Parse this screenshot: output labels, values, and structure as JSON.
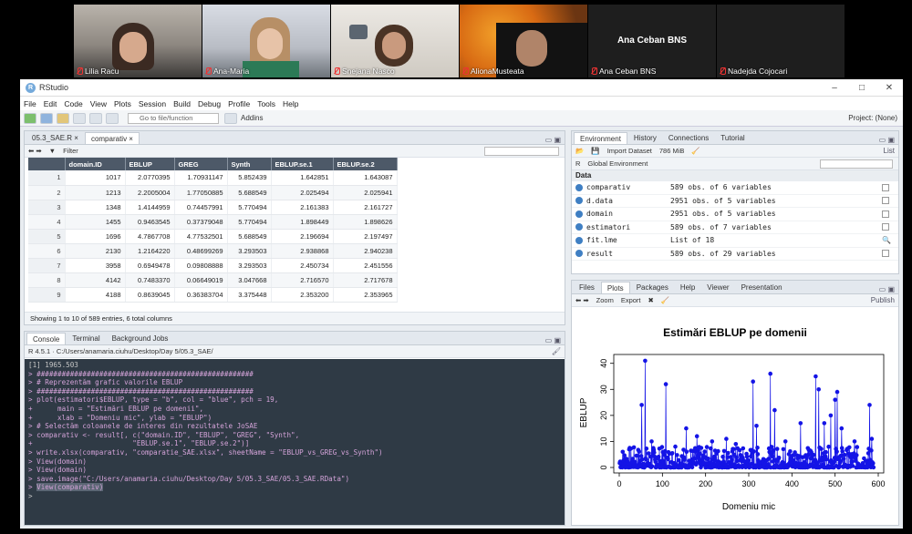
{
  "participants": [
    {
      "name": "Lilia Racu",
      "muted": true
    },
    {
      "name": "Ana-Maria",
      "muted": true
    },
    {
      "name": "Snejana Nasco",
      "muted": true
    },
    {
      "name": "AlionaMusteata",
      "muted": true
    },
    {
      "name": "Ana Ceban BNS",
      "muted": true,
      "tile_label": "Ana Ceban BNS"
    },
    {
      "name": "Nadejda Cojocari",
      "muted": true
    }
  ],
  "app": {
    "title": "RStudio",
    "menu": [
      "File",
      "Edit",
      "Code",
      "View",
      "Plots",
      "Session",
      "Build",
      "Debug",
      "Profile",
      "Tools",
      "Help"
    ],
    "goto_placeholder": "Go to file/function",
    "addins": "Addins",
    "project": "Project: (None)"
  },
  "editor": {
    "tabs": [
      "05.3_SAE.R",
      "comparativ"
    ],
    "filter_label": "Filter",
    "columns": [
      "",
      "domain.ID",
      "EBLUP",
      "GREG",
      "Synth",
      "EBLUP.se.1",
      "EBLUP.se.2"
    ],
    "rows": [
      [
        "1",
        "1017",
        "2.0770395",
        "1.70931147",
        "5.852439",
        "1.642851",
        "1.643087"
      ],
      [
        "2",
        "1213",
        "2.2005004",
        "1.77050885",
        "5.688549",
        "2.025494",
        "2.025941"
      ],
      [
        "3",
        "1348",
        "1.4144959",
        "0.74457991",
        "5.770494",
        "2.161383",
        "2.161727"
      ],
      [
        "4",
        "1455",
        "0.9463545",
        "0.37379048",
        "5.770494",
        "1.898449",
        "1.898626"
      ],
      [
        "5",
        "1696",
        "4.7867708",
        "4.77532501",
        "5.688549",
        "2.196694",
        "2.197497"
      ],
      [
        "6",
        "2130",
        "1.2164220",
        "0.48699269",
        "3.293503",
        "2.938868",
        "2.940238"
      ],
      [
        "7",
        "3958",
        "0.6949478",
        "0.09808888",
        "3.293503",
        "2.450734",
        "2.451556"
      ],
      [
        "8",
        "4142",
        "0.7483370",
        "0.06649019",
        "3.047668",
        "2.716570",
        "2.717678"
      ],
      [
        "9",
        "4188",
        "0.8639045",
        "0.36383704",
        "3.375448",
        "2.353200",
        "2.353965"
      ]
    ],
    "footer": "Showing 1 to 10 of 589 entries, 6 total columns"
  },
  "console": {
    "tabs": [
      "Console",
      "Terminal",
      "Background Jobs"
    ],
    "path": "R 4.5.1 · C:/Users/anamaria.ciuhu/Desktop/Day 5/05.3_SAE/",
    "lines": [
      {
        "t": "out",
        "s": "[1] 1965.503"
      },
      {
        "t": "cmd",
        "s": "> ####################################################"
      },
      {
        "t": "cmd",
        "s": "> # Reprezentăm grafic valorile EBLUP"
      },
      {
        "t": "cmd",
        "s": "> ####################################################"
      },
      {
        "t": "cmd",
        "s": "> plot(estimatori$EBLUP, type = \"b\", col = \"blue\", pch = 19,"
      },
      {
        "t": "cmd",
        "s": "+      main = \"Estimări EBLUP pe domenii\","
      },
      {
        "t": "cmd",
        "s": "+      xlab = \"Domeniu mic\", ylab = \"EBLUP\")"
      },
      {
        "t": "cmd",
        "s": "> # Selectăm coloanele de interes din rezultatele JoSAE"
      },
      {
        "t": "cmd",
        "s": "> comparativ <- result[, c(\"domain.ID\", \"EBLUP\", \"GREG\", \"Synth\","
      },
      {
        "t": "cmd",
        "s": "+                        \"EBLUP.se.1\", \"EBLUP.se.2\")]"
      },
      {
        "t": "cmd",
        "s": "> write.xlsx(comparativ, \"comparatie_SAE.xlsx\", sheetName = \"EBLUP_vs_GREG_vs_Synth\")"
      },
      {
        "t": "cmd",
        "s": "> View(domain)"
      },
      {
        "t": "cmd",
        "s": "> View(domain)"
      },
      {
        "t": "cmd",
        "s": "> save.image(\"C:/Users/anamaria.ciuhu/Desktop/Day 5/05.3_SAE/05.3_SAE.RData\")"
      },
      {
        "t": "hl",
        "s": "> View(comparativ)"
      },
      {
        "t": "prompt",
        "s": ">"
      }
    ]
  },
  "environment": {
    "tabs": [
      "Environment",
      "History",
      "Connections",
      "Tutorial"
    ],
    "import_label": "Import Dataset",
    "memory": "786 MiB",
    "list_label": "List",
    "scope": "Global Environment",
    "lang": "R",
    "section": "Data",
    "items": [
      {
        "name": "comparativ",
        "value": "589 obs. of 6 variables",
        "action": "box"
      },
      {
        "name": "d.data",
        "value": "2951 obs. of 5 variables",
        "action": "box"
      },
      {
        "name": "domain",
        "value": "2951 obs. of 5 variables",
        "action": "box"
      },
      {
        "name": "estimatori",
        "value": "589 obs. of 7 variables",
        "action": "box"
      },
      {
        "name": "fit.lme",
        "value": "List of  18",
        "action": "mag"
      },
      {
        "name": "result",
        "value": "589 obs. of 29 variables",
        "action": "box"
      }
    ]
  },
  "plots": {
    "tabs": [
      "Files",
      "Plots",
      "Packages",
      "Help",
      "Viewer",
      "Presentation"
    ],
    "zoom": "Zoom",
    "export": "Export",
    "publish": "Publish"
  },
  "chart_data": {
    "type": "line",
    "title": "Estimări EBLUP pe domenii",
    "xlabel": "Domeniu mic",
    "ylabel": "EBLUP",
    "xlim": [
      0,
      600
    ],
    "ylim": [
      0,
      42
    ],
    "xticks": [
      0,
      100,
      200,
      300,
      400,
      500,
      600
    ],
    "yticks": [
      0,
      10,
      20,
      30,
      40
    ],
    "color": "#1414e6",
    "n": 589,
    "peaks": [
      [
        52,
        24
      ],
      [
        60,
        41
      ],
      [
        75,
        10
      ],
      [
        108,
        32
      ],
      [
        130,
        8
      ],
      [
        155,
        15
      ],
      [
        180,
        12
      ],
      [
        215,
        10
      ],
      [
        248,
        11
      ],
      [
        270,
        9
      ],
      [
        310,
        33
      ],
      [
        318,
        16
      ],
      [
        350,
        36
      ],
      [
        360,
        22
      ],
      [
        385,
        10
      ],
      [
        420,
        17
      ],
      [
        455,
        35
      ],
      [
        462,
        30
      ],
      [
        475,
        17
      ],
      [
        490,
        20
      ],
      [
        500,
        26
      ],
      [
        505,
        29
      ],
      [
        515,
        15
      ],
      [
        545,
        10
      ],
      [
        580,
        24
      ],
      [
        585,
        11
      ]
    ],
    "baseline": [
      0,
      8
    ]
  }
}
